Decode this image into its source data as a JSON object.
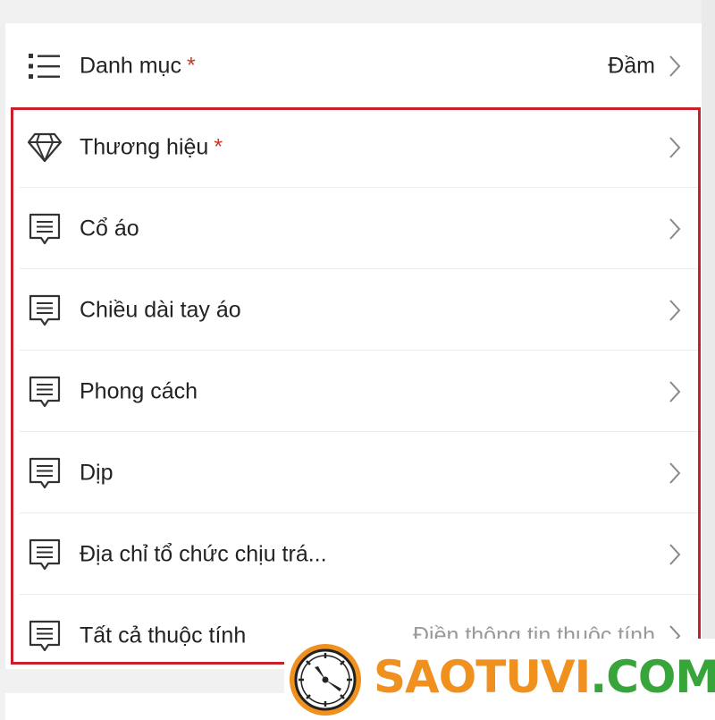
{
  "category_row": {
    "label": "Danh mục",
    "required_mark": "*",
    "value": "Đầm",
    "icon": "list-icon"
  },
  "attribute_rows": [
    {
      "label": "Thương hiệu",
      "required_mark": "*",
      "icon": "diamond-icon"
    },
    {
      "label": "Cổ áo",
      "icon": "message-icon"
    },
    {
      "label": "Chiều dài tay áo",
      "icon": "message-icon"
    },
    {
      "label": "Phong cách",
      "icon": "message-icon"
    },
    {
      "label": "Dịp",
      "icon": "message-icon"
    },
    {
      "label": "Địa chỉ tổ chức chịu trá...",
      "icon": "message-icon"
    },
    {
      "label": "Tất cả thuộc tính",
      "value": "Điền thông tin thuộc tính",
      "icon": "message-icon"
    }
  ],
  "watermark": {
    "brand_part1": "SAOTUVI",
    "brand_part2": ".COM",
    "colors": {
      "orange": "#f0901e",
      "green": "#37a53a"
    }
  },
  "colors": {
    "highlight_border": "#c8202a",
    "required_star": "#c0392b",
    "text": "#222222",
    "placeholder": "#9a9a9a"
  }
}
